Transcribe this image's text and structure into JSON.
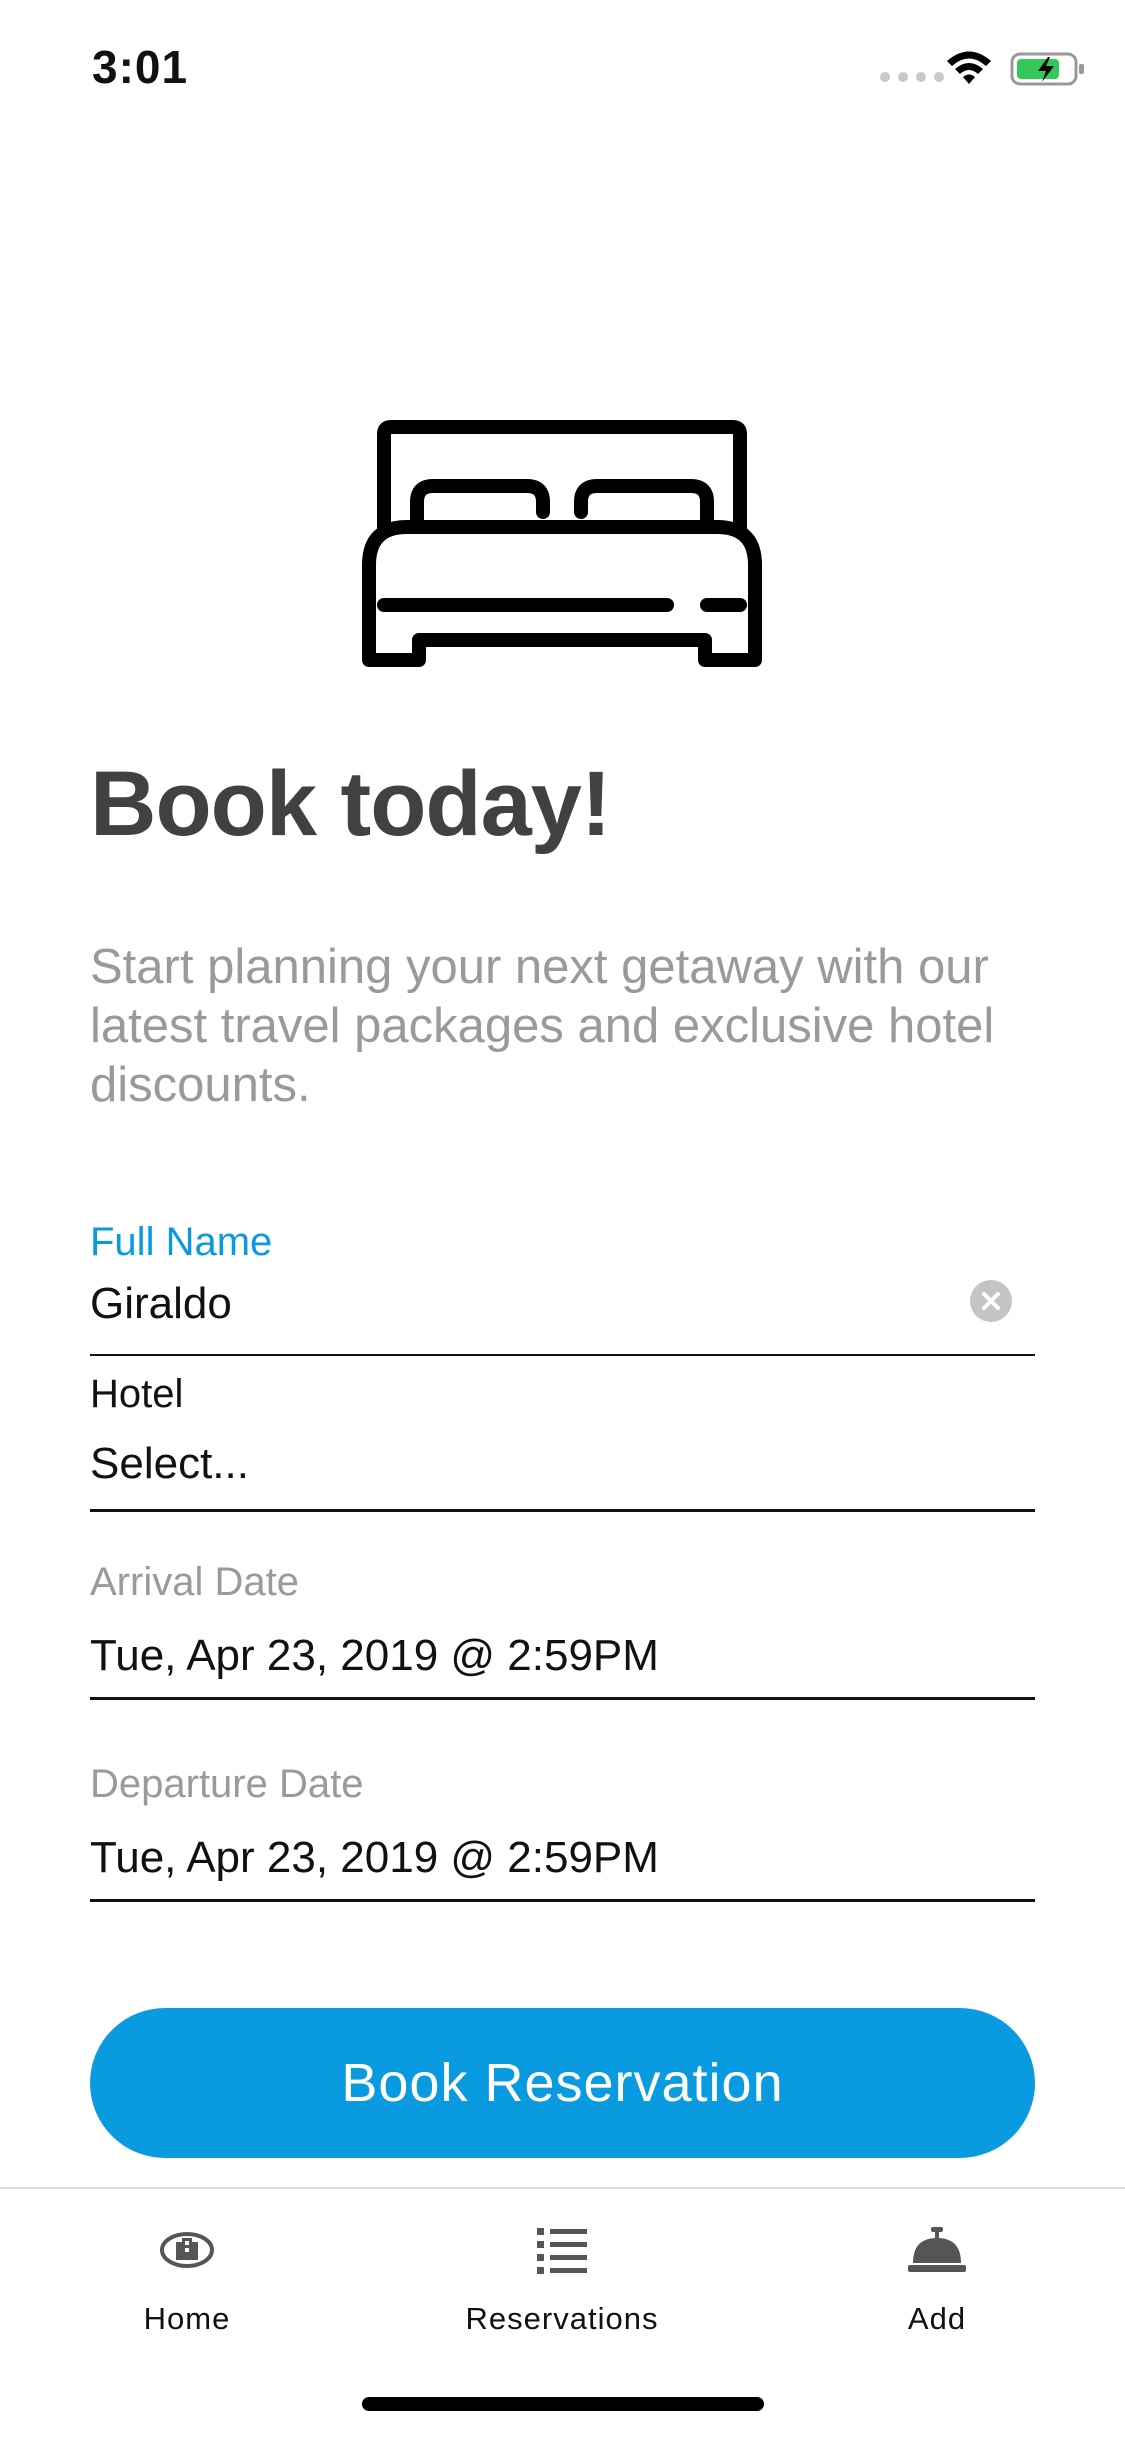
{
  "status_bar": {
    "time": "3:01",
    "battery_color": "#34c759"
  },
  "hero": {
    "icon": "bed-icon",
    "title": "Book today!",
    "subtitle": "Start planning your next getaway with our latest travel packages and exclusive hotel discounts."
  },
  "form": {
    "full_name": {
      "label": "Full Name",
      "value": "Giraldo"
    },
    "hotel": {
      "label": "Hotel",
      "value": "Select..."
    },
    "arrival": {
      "label": "Arrival Date",
      "value": "Tue, Apr 23, 2019 @ 2:59PM"
    },
    "departure": {
      "label": "Departure Date",
      "value": "Tue, Apr 23, 2019 @ 2:59PM"
    }
  },
  "book_button": {
    "label": "Book Reservation",
    "color": "#0a9ae0"
  },
  "tab_bar": {
    "tabs": [
      {
        "label": "Home",
        "icon": "hotel-logo-icon"
      },
      {
        "label": "Reservations",
        "icon": "list-icon"
      },
      {
        "label": "Add",
        "icon": "service-bell-icon"
      }
    ]
  }
}
